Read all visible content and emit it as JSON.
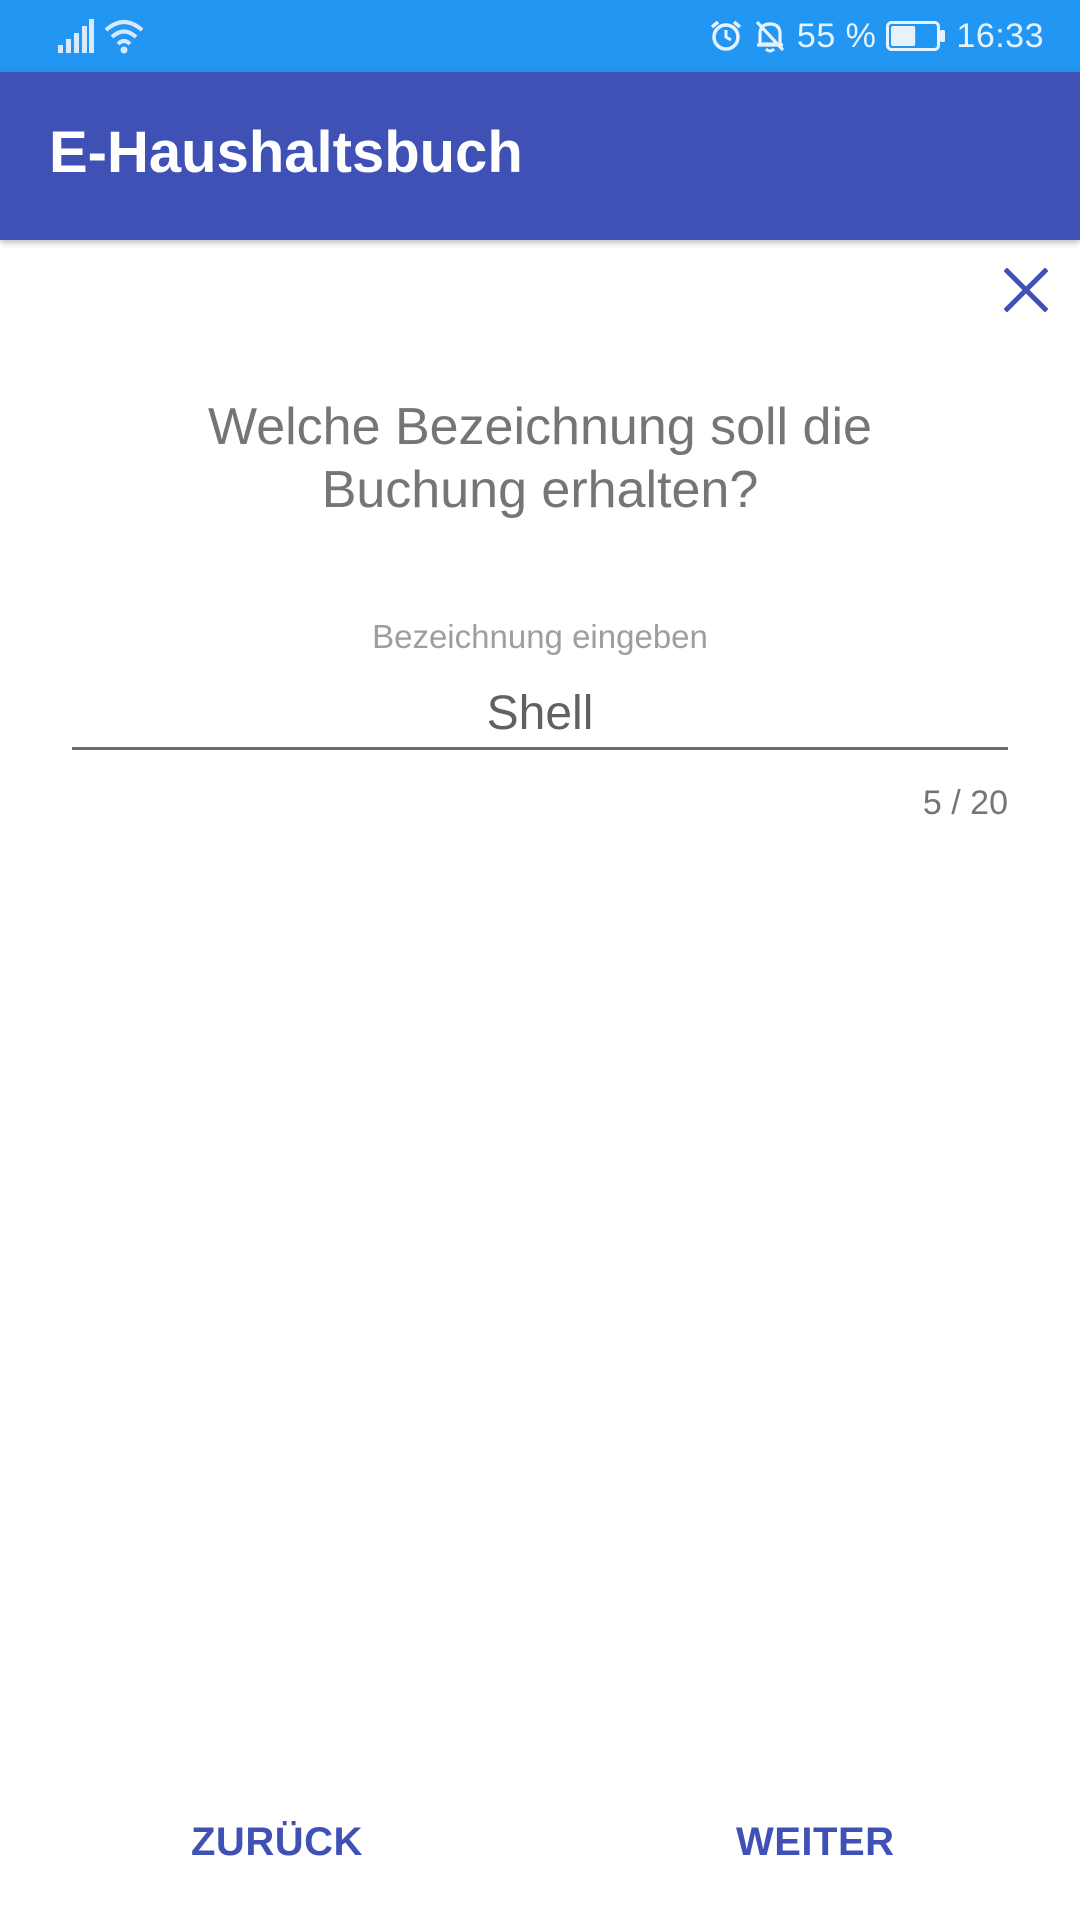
{
  "status_bar": {
    "battery_percent": "55 %",
    "time": "16:33",
    "battery_level": 0.55,
    "icons": [
      "signal-icon",
      "wifi-icon",
      "alarm-icon",
      "notifications-off-icon",
      "battery-icon"
    ]
  },
  "app_bar": {
    "title": "E-Haushaltsbuch"
  },
  "main": {
    "question": "Welche Bezeichnung soll die Buchung erhalten?",
    "input_label": "Bezeichnung eingeben",
    "input_value": "Shell",
    "counter": "5 / 20",
    "close_icon": "close-icon"
  },
  "footer": {
    "back_label": "ZURÜCK",
    "next_label": "WEITER"
  },
  "colors": {
    "status_bar": "#2196f3",
    "app_bar": "#3f51b5",
    "accent": "#3f51b5"
  }
}
